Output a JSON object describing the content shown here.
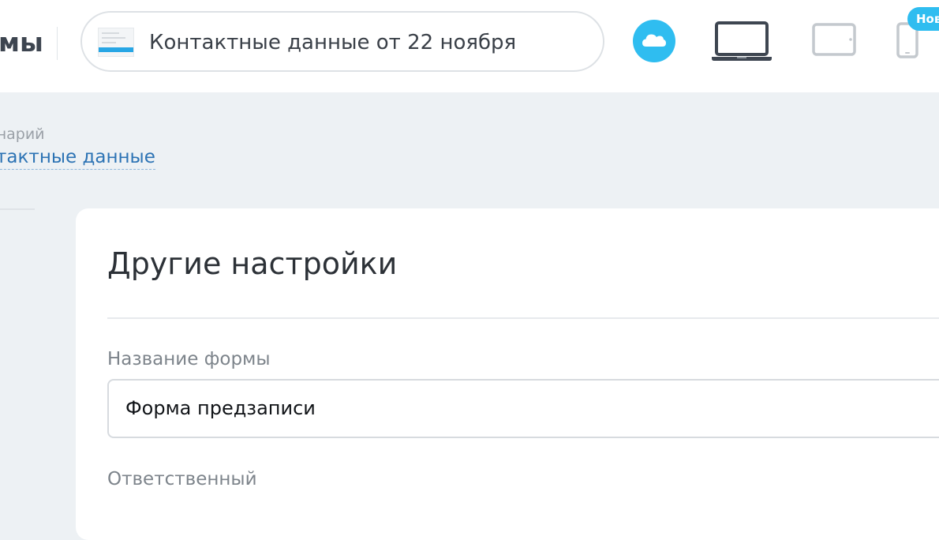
{
  "header": {
    "brand_fragment": "мы",
    "form_selector": {
      "label": "Контактные данные от 22 ноября",
      "thumbnail_icon": "form-preview-icon"
    },
    "publish_button_icon": "cloud-icon",
    "devices": [
      {
        "name": "laptop",
        "icon": "laptop-icon",
        "active": true
      },
      {
        "name": "tablet",
        "icon": "tablet-icon",
        "active": false
      },
      {
        "name": "phone",
        "icon": "phone-icon",
        "active": false
      }
    ],
    "new_badge": "Нов",
    "colors": {
      "accent": "#2fbdf0",
      "device_active": "#3e4651",
      "device_inactive": "#c4c9ce"
    }
  },
  "breadcrumb": {
    "parent": "енарий",
    "current": "нтактные данные"
  },
  "settings": {
    "title": "Другие настройки",
    "fields": {
      "form_name": {
        "label": "Название формы",
        "value": "Форма предзаписи"
      },
      "owner": {
        "label": "Ответственный"
      }
    }
  }
}
